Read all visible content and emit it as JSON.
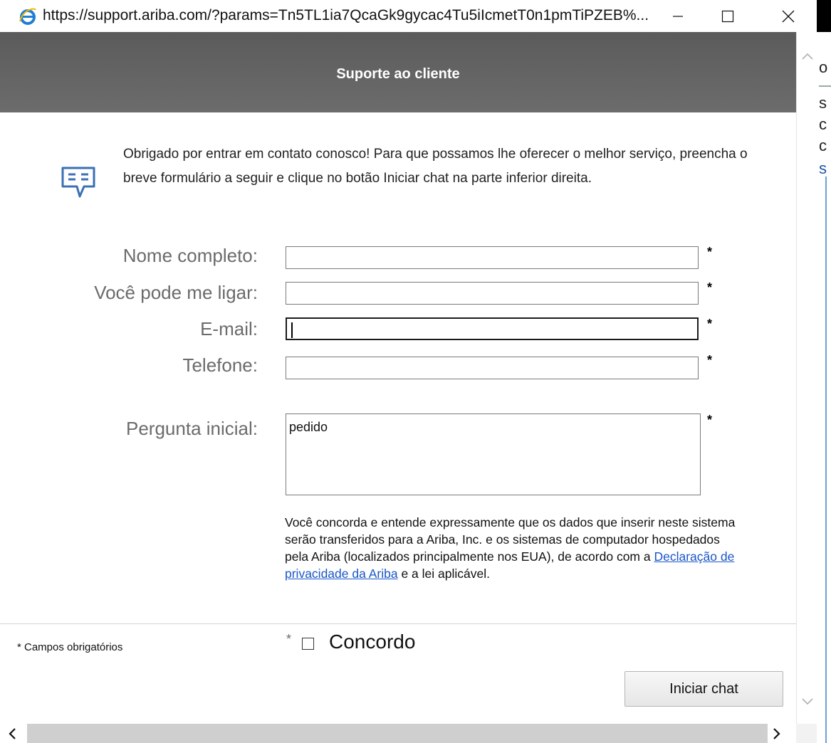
{
  "browser": {
    "url": "https://support.ariba.com/?params=Tn5TL1ia7QcaGk9gycac4Tu5iIcmetT0n1pmTiPZEB%..."
  },
  "background_fragments": [
    "o",
    "s",
    "c",
    "c",
    "s"
  ],
  "header": {
    "title": "Suporte ao cliente"
  },
  "intro_text": "Obrigado por entrar em contato conosco! Para que possamos lhe oferecer o melhor serviço, preencha o breve formulário a seguir e clique no botão Iniciar chat na parte inferior direita.",
  "form": {
    "required_marker": "*",
    "fields": [
      {
        "label": "Nome completo:",
        "value": ""
      },
      {
        "label": "Você pode me ligar:",
        "value": ""
      },
      {
        "label": "E-mail:",
        "value": ""
      },
      {
        "label": "Telefone:",
        "value": ""
      }
    ],
    "question": {
      "label": "Pergunta inicial:",
      "value": "pedido"
    }
  },
  "consent": {
    "text_before": "Você concorda e entende expressamente que os dados que inserir neste sistema serão transferidos para a Ariba, Inc. e os sistemas de computador hospedados pela Ariba (localizados principalmente nos EUA), de acordo com a ",
    "link": "Declaração de privacidade da Ariba",
    "text_after": " e a lei aplicável."
  },
  "footer": {
    "required_note": "* Campos obrigatórios",
    "agree_marker": "*",
    "agree_label": "Concordo",
    "agree_checked": false,
    "start_chat_label": "Iniciar chat"
  },
  "colors": {
    "header_bg": "#626262",
    "link": "#1a56c8",
    "accent_orange": "#f0a500"
  },
  "icons": [
    "ie-icon",
    "minimize-icon",
    "maximize-icon",
    "close-icon",
    "chat-icon",
    "scroll-up-icon",
    "scroll-down-icon",
    "scroll-left-icon",
    "scroll-right-icon"
  ]
}
